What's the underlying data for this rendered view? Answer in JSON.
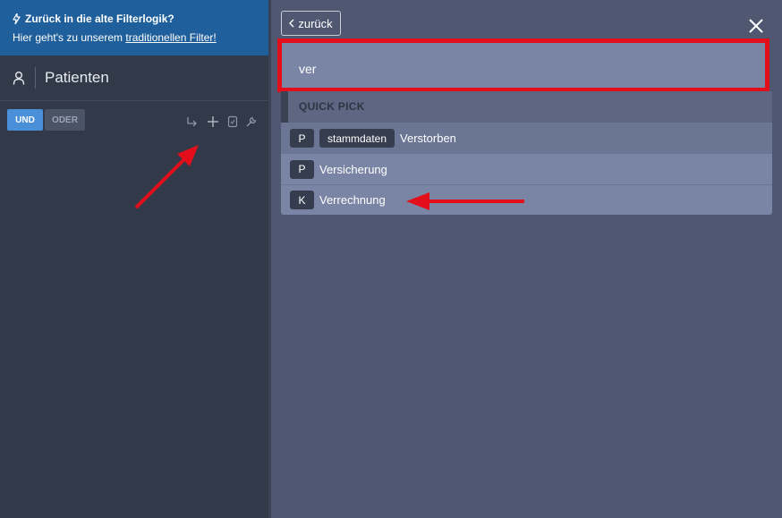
{
  "banner": {
    "title": "Zurück in die alte Filterlogik?",
    "text_prefix": "Hier geht's zu unserem ",
    "link": "traditionellen Filter!"
  },
  "sidebar": {
    "entity_label": "Patienten",
    "und_label": "UND",
    "oder_label": "ODER",
    "tool_icons": [
      "branch-arrow-icon",
      "plus-icon",
      "checklist-icon",
      "wrench-icon"
    ]
  },
  "panel": {
    "back_label": "zurück",
    "search_value": "ver",
    "quick_pick_label": "QUICK PICK",
    "results": [
      {
        "type": "P",
        "chip": "stammdaten",
        "label": "Verstorben"
      },
      {
        "type": "P",
        "chip": "",
        "label": "Versicherung"
      },
      {
        "type": "K",
        "chip": "",
        "label": "Verrechnung"
      }
    ]
  },
  "colors": {
    "banner": "#1f5f9b",
    "sidebar": "#323a4a",
    "panel": "#4f5870",
    "highlight": "#e20f1a",
    "und_active": "#4a90d9"
  }
}
